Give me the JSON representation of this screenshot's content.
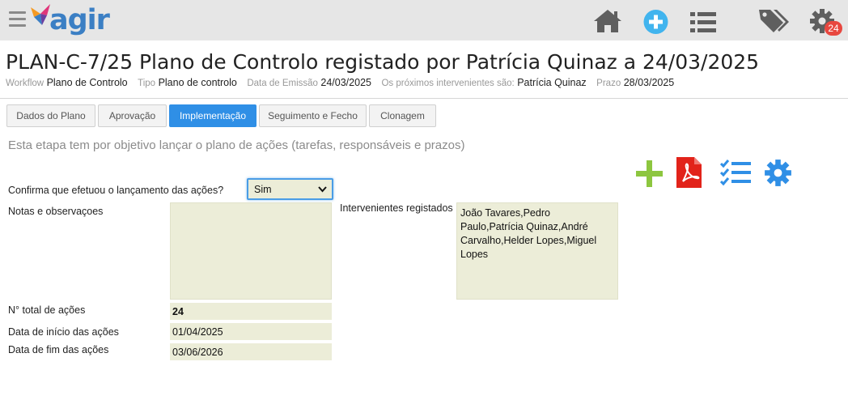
{
  "app": {
    "logo_text": "agir",
    "notification_count": "24"
  },
  "top_icons": [
    "home-icon",
    "plus-circle-icon",
    "list-icon",
    "tags-icon",
    "gear-icon"
  ],
  "header": {
    "title": "PLAN-C-7/25 Plano de Controlo registado por Patrícia Quinaz a 24/03/2025",
    "meta": {
      "workflow_label": "Workflow",
      "workflow_value": "Plano de Controlo",
      "tipo_label": "Tipo",
      "tipo_value": "Plano de controlo",
      "emissao_label": "Data de Emissão",
      "emissao_value": "24/03/2025",
      "intervenientes_label": "Os próximos intervenientes são:",
      "intervenientes_value": "Patrícia Quinaz",
      "prazo_label": "Prazo",
      "prazo_value": "28/03/2025"
    }
  },
  "tabs": [
    {
      "label": "Dados do Plano",
      "active": false
    },
    {
      "label": "Aprovação",
      "active": false
    },
    {
      "label": "Implementação",
      "active": true
    },
    {
      "label": "Seguimento e Fecho",
      "active": false
    },
    {
      "label": "Clonagem",
      "active": false
    }
  ],
  "main": {
    "description": "Esta etapa tem por objetivo lançar o plano de ações (tarefas, responsáveis e prazos)",
    "action_icons": [
      "add-icon",
      "pdf-icon",
      "checklist-icon",
      "settings-icon"
    ],
    "confirm_label": "Confirma que efetuou o lançamento das ações?",
    "confirm_value": "Sim",
    "notes_label": "Notas e observaçoes",
    "notes_value": "",
    "intervenientes_label": "Intervenientes registados",
    "intervenientes_value": "João Tavares,Pedro Paulo,Patrícia Quinaz,André Carvalho,Helder Lopes,Miguel Lopes",
    "total_acoes_label": "N° total de ações",
    "total_acoes_value": "24",
    "inicio_label": "Data de início das ações",
    "inicio_value": "01/04/2025",
    "fim_label": "Data de fim das ações",
    "fim_value": "03/06/2026"
  },
  "colors": {
    "accent": "#2f8fe6",
    "field_bg": "#ecedd8",
    "add_green": "#8dc63f",
    "pdf_red": "#e2231a",
    "badge_red": "#e8473f"
  }
}
